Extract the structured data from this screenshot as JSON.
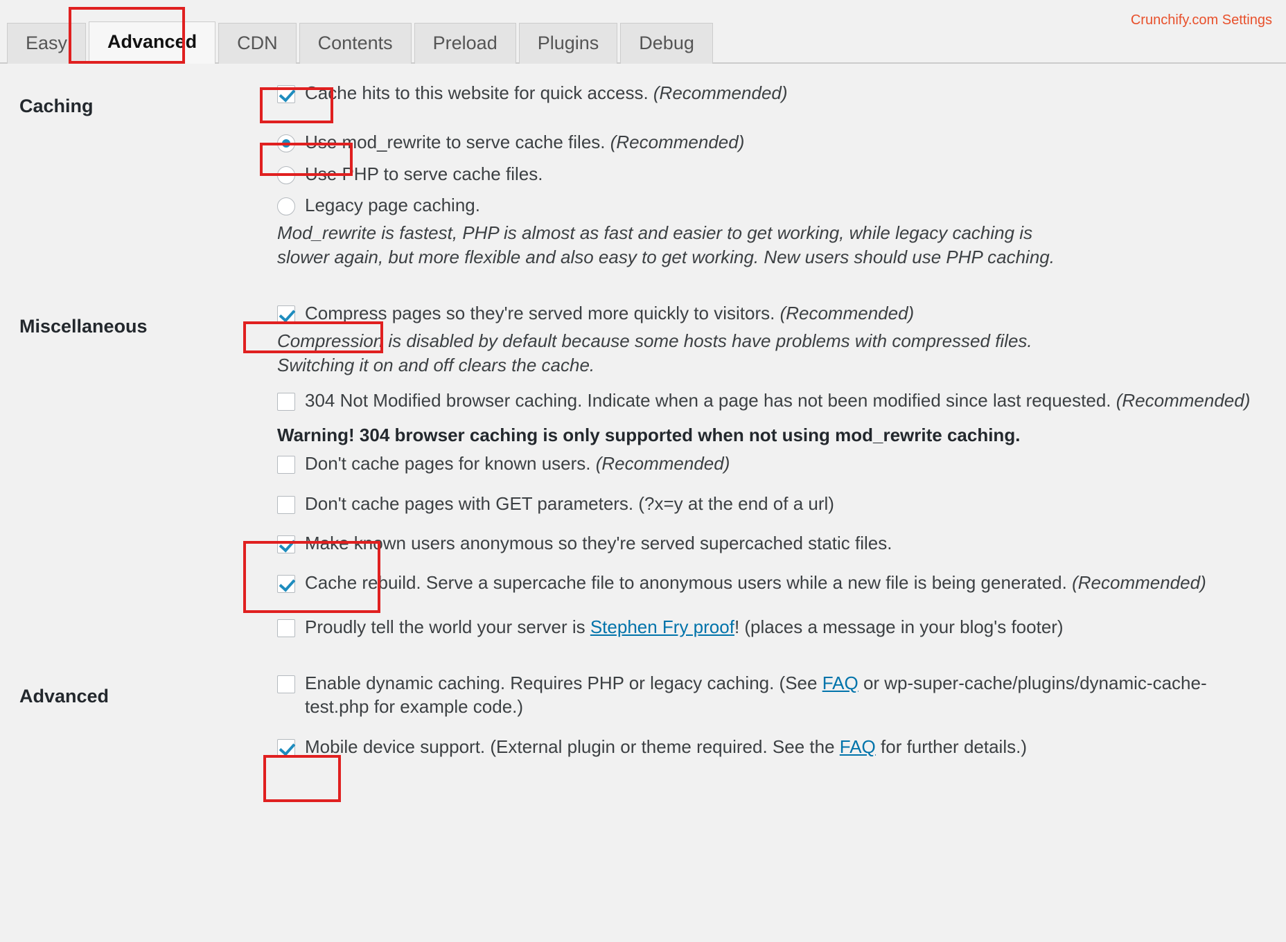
{
  "header": {
    "branding": "Crunchify.com Settings",
    "tabs": [
      {
        "label": "Easy",
        "active": false
      },
      {
        "label": "Advanced",
        "active": true
      },
      {
        "label": "CDN",
        "active": false
      },
      {
        "label": "Contents",
        "active": false
      },
      {
        "label": "Preload",
        "active": false
      },
      {
        "label": "Plugins",
        "active": false
      },
      {
        "label": "Debug",
        "active": false
      }
    ]
  },
  "colors": {
    "accent_red": "#e02020",
    "branding_orange": "#e8502b",
    "link_blue": "#0073aa",
    "control_blue": "#1e8cbe",
    "page_bg": "#f1f1f1"
  },
  "sections": {
    "caching": {
      "label": "Caching",
      "cache_hits": {
        "text": "Cache hits to this website for quick access. ",
        "recommended": "(Recommended)",
        "checked": true
      },
      "serve_method": {
        "options": [
          {
            "text": "Use mod_rewrite to serve cache files. ",
            "recommended": "(Recommended)",
            "selected": true
          },
          {
            "text": "Use PHP to serve cache files.",
            "recommended": "",
            "selected": false
          },
          {
            "text": "Legacy page caching.",
            "recommended": "",
            "selected": false
          }
        ],
        "description": "Mod_rewrite is fastest, PHP is almost as fast and easier to get working, while legacy caching is slower again, but more flexible and also easy to get working. New users should use PHP caching."
      }
    },
    "miscellaneous": {
      "label": "Miscellaneous",
      "compress": {
        "text": "Compress pages so they're served more quickly to visitors. ",
        "recommended": "(Recommended)",
        "checked": true,
        "description": "Compression is disabled by default because some hosts have problems with compressed files. Switching it on and off clears the cache."
      },
      "not_modified": {
        "text": "304 Not Modified browser caching. Indicate when a page has not been modified since last requested. ",
        "recommended": "(Recommended)",
        "checked": false
      },
      "warning": "Warning! 304 browser caching is only supported when not using mod_rewrite caching.",
      "known_users": {
        "text": "Don't cache pages for known users. ",
        "recommended": "(Recommended)",
        "checked": false
      },
      "get_params": {
        "text": "Don't cache pages with GET parameters. (?x=y at the end of a url)",
        "recommended": "",
        "checked": false
      },
      "anonymous": {
        "text": "Make known users anonymous so they're served supercached static files.",
        "recommended": "",
        "checked": true
      },
      "cache_rebuild": {
        "text": "Cache rebuild. Serve a supercache file to anonymous users while a new file is being generated. ",
        "recommended": "(Recommended)",
        "checked": true
      },
      "stephen_fry": {
        "text_before": "Proudly tell the world your server is ",
        "link": "Stephen Fry proof",
        "text_after": "! (places a message in your blog's footer)",
        "checked": false
      }
    },
    "advanced": {
      "label": "Advanced",
      "dynamic_caching": {
        "text_before": "Enable dynamic caching. Requires PHP or legacy caching. (See ",
        "link": "FAQ",
        "text_after": " or wp-super-cache/plugins/dynamic-cache-test.php for example code.)",
        "checked": false
      },
      "mobile_support": {
        "text_before": "Mobile device support. (External plugin or theme required. See the ",
        "link": "FAQ",
        "text_after": " for further details.)",
        "checked": true
      }
    }
  }
}
